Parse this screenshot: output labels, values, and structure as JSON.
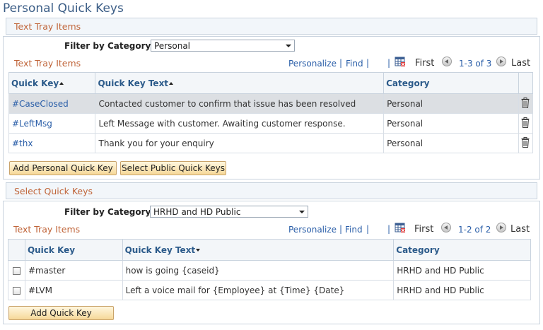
{
  "page": {
    "title": "Personal Quick Keys"
  },
  "section1": {
    "header": "Text Tray Items",
    "filter": {
      "label": "Filter by Category",
      "value": "Personal"
    },
    "grid": {
      "title": "Text Tray Items",
      "personalize": "Personalize",
      "find": "Find",
      "first": "First",
      "range": "1-3 of 3",
      "last": "Last",
      "columns": {
        "key": "Quick Key",
        "text": "Quick Key Text",
        "category": "Category"
      },
      "rows": [
        {
          "key": "#CaseClosed",
          "text": "Contacted customer to confirm that issue has been resolved",
          "category": "Personal"
        },
        {
          "key": "#LeftMsg",
          "text": "Left Message with customer. Awaiting customer response.",
          "category": "Personal"
        },
        {
          "key": "#thx",
          "text": "Thank you for your enquiry",
          "category": "Personal"
        }
      ]
    },
    "buttons": {
      "add": "Add Personal Quick Key",
      "select_public": "Select Public Quick Keys"
    }
  },
  "section2": {
    "header": "Select Quick Keys",
    "filter": {
      "label": "Filter by Category",
      "value": "HRHD and HD Public"
    },
    "grid": {
      "title": "Text Tray Items",
      "personalize": "Personalize",
      "find": "Find",
      "first": "First",
      "range": "1-2 of 2",
      "last": "Last",
      "columns": {
        "key": "Quick Key",
        "text": "Quick Key Text",
        "category": "Category"
      },
      "rows": [
        {
          "key": "#master",
          "text": "how is going {caseid}",
          "category": "HRHD and HD Public"
        },
        {
          "key": "#LVM",
          "text": "Left a voice mail for {Employee} at {Time} {Date}",
          "category": "HRHD and HD Public"
        }
      ]
    },
    "buttons": {
      "add": "Add Quick Key"
    }
  },
  "colors": {
    "accent_orange": "#c0653a",
    "link_blue": "#2a5ea8",
    "header_blue": "#2b5a8a",
    "button_fill": "#f6d898"
  },
  "icons": [
    "trash-icon",
    "grid-view-icon",
    "previous-icon",
    "next-icon",
    "sort-ascending-icon",
    "sort-descending-icon",
    "dropdown-arrow-icon"
  ]
}
